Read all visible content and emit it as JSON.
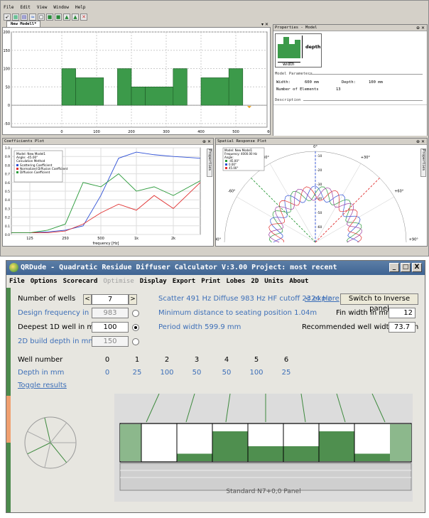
{
  "top_app": {
    "menu": [
      "File",
      "Edit",
      "View",
      "Window",
      "Help"
    ],
    "tab_label": "New Modell*",
    "model_panel": {
      "y_ticks": [
        "200",
        "150",
        "100",
        "50",
        "0",
        "-50"
      ],
      "x_ticks": [
        "0",
        "100",
        "200",
        "300",
        "400",
        "500",
        "600"
      ],
      "wells": [
        {
          "start": 0,
          "end": 40,
          "depth": 100
        },
        {
          "start": 40,
          "end": 120,
          "depth": 75
        },
        {
          "start": 160,
          "end": 200,
          "depth": 100
        },
        {
          "start": 200,
          "end": 240,
          "depth": 50
        },
        {
          "start": 240,
          "end": 320,
          "depth": 50
        },
        {
          "start": 320,
          "end": 360,
          "depth": 100
        },
        {
          "start": 400,
          "end": 480,
          "depth": 75
        },
        {
          "start": 480,
          "end": 520,
          "depth": 100
        }
      ]
    },
    "properties_panel": {
      "title": "Properties - Model",
      "depth_label": "depth",
      "width_label": "width",
      "section_model_params": "Model Parameters",
      "width_key": "Width:",
      "width_val": "600 mm",
      "depth_key": "Depth:",
      "depth_val": "100 mm",
      "elements_key": "Number of Elements",
      "elements_val": "13",
      "section_description": "Description"
    },
    "coefficients_panel": {
      "title": "Coefficients Plot",
      "side_tab": "Properties",
      "legend": {
        "model": "Model:  New Model1",
        "angle": "Angle:  -45.00°",
        "calc": "Calculation Method",
        "items": [
          "Scattering Coefficient",
          "Normalized Diffusion Coefficient",
          "Diffusion Coefficient"
        ]
      },
      "x_ticks": [
        "125",
        "250",
        "500",
        "1k",
        "2k"
      ],
      "y_ticks": [
        "1.0",
        "0.9",
        "0.8",
        "0.7",
        "0.6",
        "0.5",
        "0.4",
        "0.3",
        "0.2",
        "0.1",
        "0.0"
      ],
      "xlabel": "frequency [Hz]",
      "series_colors": [
        "#2d4fd6",
        "#e03030",
        "#2a9a3a"
      ]
    },
    "spatial_panel": {
      "title": "Spatial Response Plot",
      "side_tab": "Properties",
      "legend": {
        "model": "Model:  New Model1",
        "freq": "Frequency:  4000.00 Hz",
        "angle": "Angle:",
        "items": [
          "-45.00°",
          "0.00°",
          "45.00°"
        ]
      },
      "angle_labels": [
        "0°",
        "-30°",
        "+30°",
        "-60°",
        "+60°",
        "-90°",
        "+90°"
      ],
      "ring_labels": [
        "-10",
        "-20",
        "-30",
        "-40",
        "-50",
        "-60"
      ]
    }
  },
  "qrdude": {
    "title": "QRDude - Quadratic Residue Diffuser Calculator     V:3.00     Project: most recent",
    "window_buttons": [
      "_",
      "□",
      "X"
    ],
    "menu": [
      "File",
      "Options",
      "Scorecard",
      "Optimise",
      "Display",
      "Export",
      "Print",
      "Lobes",
      "2D",
      "Units",
      "About"
    ],
    "menu_disabled": [
      "Optimise"
    ],
    "number_of_wells_label": "Number of wells",
    "number_of_wells_value": "7",
    "design_freq_label": "Design frequency in Hz",
    "design_freq_value": "983",
    "deepest_label": "Deepest 1D well in mm",
    "deepest_value": "100",
    "build_depth_label": "2D build depth in mm",
    "build_depth_value": "150",
    "freq_info": "Scatter 491 Hz   Diffuse 983 Hz   HF cutoff 2324 Hz",
    "explore_link": "< explore",
    "switch_button": "Switch to Inverse panel",
    "min_distance": "Minimum distance to seating position  1.04m",
    "fin_width_label": "Fin width in mm",
    "fin_width_value": "12",
    "period_width": "Period width  599.9 mm",
    "rec_width_label": "Recommended well width  39mm",
    "rec_width_value": "73.7",
    "well_number_label": "Well number",
    "well_numbers": [
      "0",
      "1",
      "2",
      "3",
      "4",
      "5",
      "6"
    ],
    "depth_label": "Depth in mm",
    "depths": [
      "0",
      "25",
      "100",
      "50",
      "50",
      "100",
      "25"
    ],
    "toggle_results": "Toggle results",
    "panel_caption": "Standard N7+0,0 Panel",
    "colors": {
      "well_green": "#4f8f4f",
      "light_green": "#8cb88c",
      "accent_blue": "#3d6fb8"
    }
  }
}
